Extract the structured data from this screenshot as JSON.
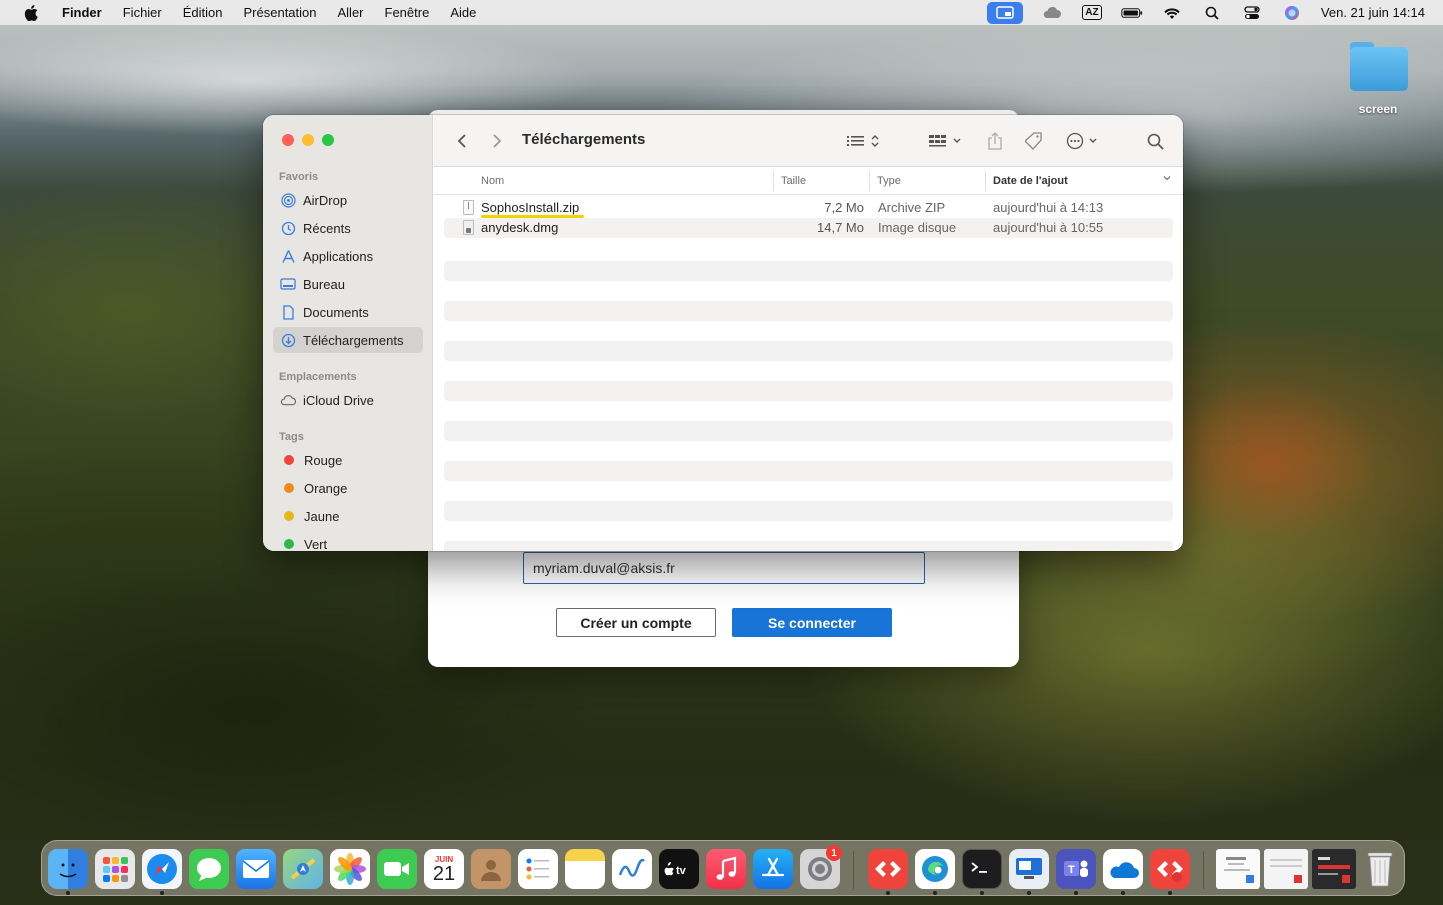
{
  "menubar": {
    "app": "Finder",
    "items": [
      "Fichier",
      "Édition",
      "Présentation",
      "Aller",
      "Fenêtre",
      "Aide"
    ],
    "status_icons": {
      "keyboard_layout": "AZ"
    },
    "clock": "Ven. 21 juin  14:14"
  },
  "desktop": {
    "folder_label": "screen"
  },
  "login_dialog": {
    "email_value": "myriam.duval@aksis.fr",
    "create_account_label": "Créer un compte",
    "connect_label": "Se connecter",
    "connect_color": "#1874d6"
  },
  "finder": {
    "title": "Téléchargements",
    "sidebar": {
      "favorites_header": "Favoris",
      "favorites": [
        {
          "label": "AirDrop",
          "icon": "airdrop-icon"
        },
        {
          "label": "Récents",
          "icon": "clock-icon"
        },
        {
          "label": "Applications",
          "icon": "applications-icon"
        },
        {
          "label": "Bureau",
          "icon": "desktop-icon"
        },
        {
          "label": "Documents",
          "icon": "document-icon"
        },
        {
          "label": "Téléchargements",
          "icon": "download-icon",
          "selected": true
        }
      ],
      "locations_header": "Emplacements",
      "locations": [
        {
          "label": "iCloud Drive",
          "icon": "cloud-icon"
        }
      ],
      "tags_header": "Tags",
      "tags": [
        {
          "label": "Rouge",
          "color": "#f0453a"
        },
        {
          "label": "Orange",
          "color": "#f08c1e"
        },
        {
          "label": "Jaune",
          "color": "#e6b818"
        },
        {
          "label": "Vert",
          "color": "#2db84a"
        }
      ]
    },
    "columns": {
      "name": "Nom",
      "size": "Taille",
      "type": "Type",
      "date": "Date de l'ajout"
    },
    "files": [
      {
        "name": "SophosInstall.zip",
        "size": "7,2 Mo",
        "type": "Archive ZIP",
        "date": "aujourd'hui à 14:13"
      },
      {
        "name": "anydesk.dmg",
        "size": "14,7 Mo",
        "type": "Image disque",
        "date": "aujourd'hui à 10:55"
      }
    ]
  },
  "dock": {
    "calendar_month": "JUIN",
    "calendar_day": "21",
    "settings_badge": "1",
    "apps": [
      "finder",
      "launchpad",
      "safari",
      "messages",
      "mail",
      "maps",
      "photos",
      "facetime",
      "calendar",
      "contacts",
      "reminders",
      "notes",
      "freeform",
      "tv",
      "music",
      "app-store",
      "system-settings",
      "anydesk",
      "edge",
      "terminal",
      "remote-desktop",
      "teams",
      "onedrive",
      "anydesk-installer"
    ]
  }
}
